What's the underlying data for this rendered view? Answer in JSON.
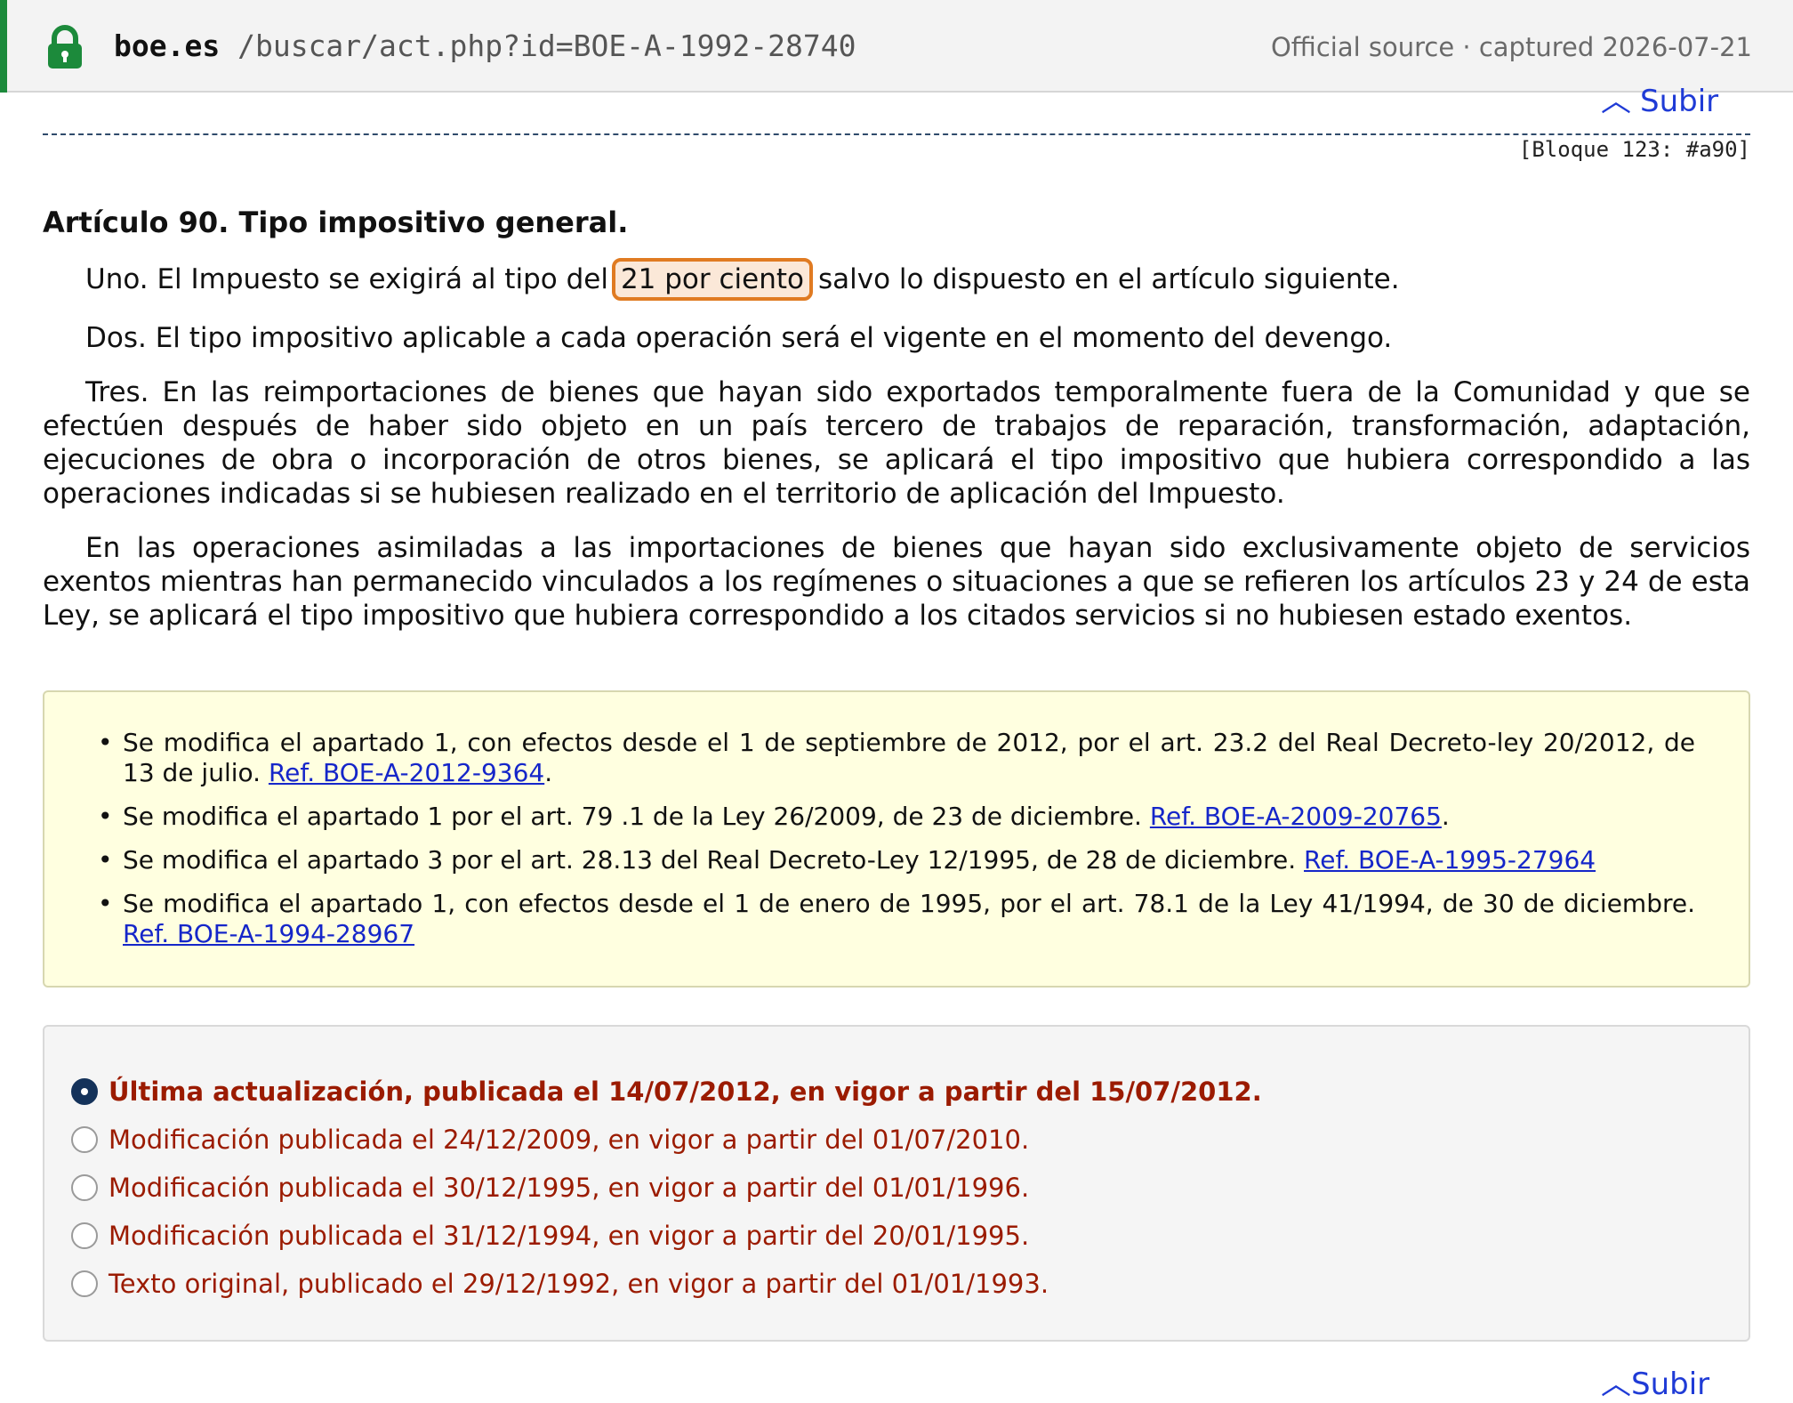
{
  "topbar": {
    "domain": "boe.es",
    "path": "/buscar/act.php?id=BOE-A-1992-28740",
    "meta": "Official source · captured 2026-07-21",
    "icon": "lock-icon",
    "accent_color": "#1c8a3b"
  },
  "nav": {
    "subir_label": "Subir",
    "subir_icon": "chevron-up-icon"
  },
  "block_ref": "[Bloque 123: #a90]",
  "article": {
    "title": "Artículo 90. Tipo impositivo general.",
    "uno_before": "Uno. El Impuesto se exigirá al tipo del",
    "uno_highlight": "21 por ciento",
    "uno_after": "salvo lo dispuesto en el artículo siguiente.",
    "dos": "Dos. El tipo impositivo aplicable a cada operación será el vigente en el momento del devengo.",
    "tres": "Tres. En las reimportaciones de bienes que hayan sido exportados temporalmente fuera de la Comunidad y que se efectúen después de haber sido objeto en un país tercero de trabajos de reparación, transformación, adaptación, ejecuciones de obra o incorporación de otros bienes, se aplicará el tipo impositivo que hubiera correspondido a las operaciones indicadas si se hubiesen realizado en el territorio de aplicación del Impuesto.",
    "cuatro": "En las operaciones asimiladas a las importaciones de bienes que hayan sido exclusivamente objeto de servicios exentos mientras han permanecido vinculados a los regímenes o situaciones a que se refieren los artículos 23 y 24 de esta Ley, se aplicará el tipo impositivo que hubiera correspondido a los citados servicios si no hubiesen estado exentos.",
    "highlight_color": "#e07b22"
  },
  "notes": [
    {
      "text": "Se modifica el apartado 1, con efectos desde el 1 de septiembre de 2012, por el art. 23.2 del Real Decreto-ley 20/2012, de 13 de julio. ",
      "ref": "Ref. BOE-A-2012-9364",
      "tail": "."
    },
    {
      "text": "Se modifica el apartado 1 por el art. 79 .1 de la Ley 26/2009, de 23 de diciembre. ",
      "ref": "Ref. BOE-A-2009-20765",
      "tail": "."
    },
    {
      "text": "Se modifica el apartado 3 por el art. 28.13 del Real Decreto-Ley 12/1995, de 28 de diciembre. ",
      "ref": "Ref. BOE-A-1995-27964",
      "tail": ""
    },
    {
      "text": "Se modifica el apartado 1, con efectos desde el 1 de enero de 1995, por el art. 78.1 de la Ley 41/1994, de 30 de diciembre. ",
      "ref": "Ref. BOE-A-1994-28967",
      "tail": ""
    }
  ],
  "versions": [
    {
      "label": "Última actualización, publicada el 14/07/2012, en vigor a partir del 15/07/2012.",
      "selected": true
    },
    {
      "label": "Modificación publicada el 24/12/2009, en vigor a partir del 01/07/2010.",
      "selected": false
    },
    {
      "label": "Modificación publicada el 30/12/1995, en vigor a partir del 01/01/1996.",
      "selected": false
    },
    {
      "label": "Modificación publicada el 31/12/1994, en vigor a partir del 20/01/1995.",
      "selected": false
    },
    {
      "label": "Texto original, publicado el 29/12/1992, en vigor a partir del 01/01/1993.",
      "selected": false
    }
  ]
}
